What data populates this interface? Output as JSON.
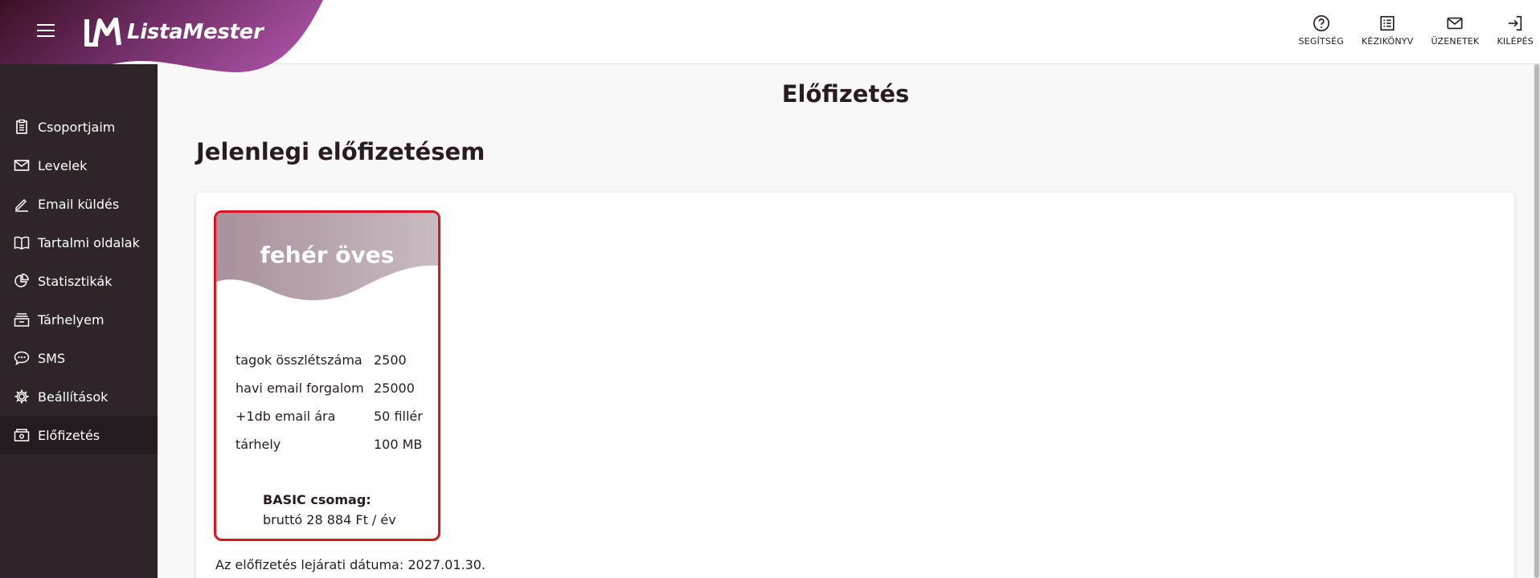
{
  "header": {
    "logo_text": "ListaMester",
    "actions": [
      {
        "label": "SEGÍTSÉG",
        "icon": "help-icon"
      },
      {
        "label": "KÉZIKÖNYV",
        "icon": "manual-icon"
      },
      {
        "label": "ÜZENETEK",
        "icon": "mail-icon"
      },
      {
        "label": "KILÉPÉS",
        "icon": "logout-icon"
      }
    ]
  },
  "sidebar": {
    "items": [
      {
        "label": "Csoportjaim",
        "icon": "clipboard-icon"
      },
      {
        "label": "Levelek",
        "icon": "envelope-icon"
      },
      {
        "label": "Email küldés",
        "icon": "pen-icon"
      },
      {
        "label": "Tartalmi oldalak",
        "icon": "book-icon"
      },
      {
        "label": "Statisztikák",
        "icon": "pie-chart-icon"
      },
      {
        "label": "Tárhelyem",
        "icon": "storage-icon"
      },
      {
        "label": "SMS",
        "icon": "sms-icon"
      },
      {
        "label": "Beállítások",
        "icon": "gear-icon"
      },
      {
        "label": "Előfizetés",
        "icon": "subscription-icon",
        "active": true
      }
    ]
  },
  "main": {
    "page_title": "Előfizetés",
    "section_title": "Jelenlegi előfizetésem",
    "plan": {
      "name": "fehér öves",
      "rows": [
        {
          "key": "tagok összlétszáma",
          "value": "2500"
        },
        {
          "key": "havi email forgalom",
          "value": "25000"
        },
        {
          "key": "+1db email ára",
          "value": "50 fillér"
        },
        {
          "key": "tárhely",
          "value": "100 MB"
        }
      ],
      "price_title": "BASIC csomag:",
      "price_value": "bruttó 28 884 Ft / év"
    },
    "expiry_text": "Az előfizetés lejárati dátuma: 2027.01.30."
  },
  "colors": {
    "brand_purple": "#9b4a94",
    "brand_dark": "#3a1024",
    "sidebar_bg": "#2e2429",
    "highlight_red": "#e0141f"
  }
}
